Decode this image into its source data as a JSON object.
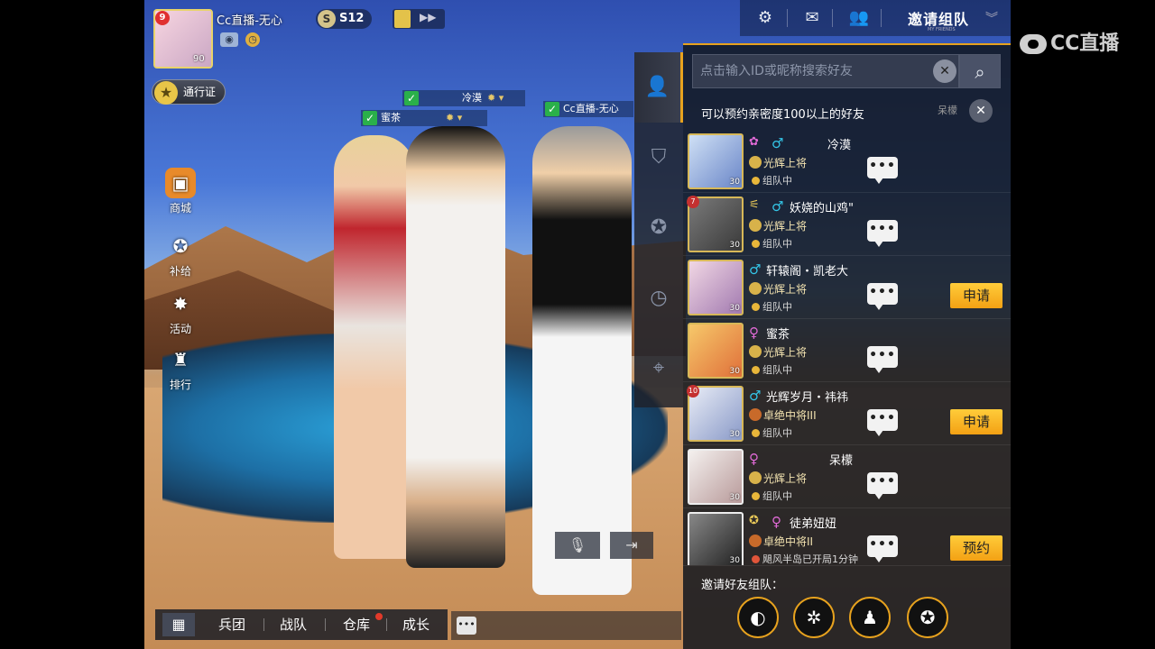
{
  "watermark": "CC直播",
  "player": {
    "name": "Cc直播-无心",
    "level_badge": "9",
    "level": "90",
    "season": "S12",
    "pass_label": "通行证"
  },
  "left_menu": [
    {
      "label": "商城",
      "icon": "shop-bag-icon"
    },
    {
      "label": "补给",
      "icon": "supply-icon"
    },
    {
      "label": "活动",
      "icon": "event-star-icon"
    },
    {
      "label": "排行",
      "icon": "ranking-icon"
    }
  ],
  "name_tags": [
    {
      "name": "冷漠"
    },
    {
      "name": "蜜茶"
    },
    {
      "name": "Cc直播-无心"
    }
  ],
  "top_nav": {
    "invite_title": "邀请组队",
    "invite_subtitle": "MY FRIENDS"
  },
  "search": {
    "placeholder": "点击输入ID或昵称搜索好友"
  },
  "hint": "可以预约亲密度100以上的好友",
  "hint_ghost": "呆檬",
  "friends": [
    {
      "name": "冷漠",
      "sex": "♂",
      "rank": "光辉上将",
      "status": "组队中",
      "level": "30",
      "action": ""
    },
    {
      "name": "妖娆的山鸡\"",
      "sex": "♂",
      "rank": "光辉上将",
      "status": "组队中",
      "level": "30",
      "vip": "7",
      "action": ""
    },
    {
      "name": "轩辕阁・凯老大",
      "sex": "♂",
      "rank": "光辉上将",
      "status": "组队中",
      "level": "30",
      "action": "申请"
    },
    {
      "name": "蜜茶",
      "sex": "♀",
      "rank": "光辉上将",
      "status": "组队中",
      "level": "30",
      "action": ""
    },
    {
      "name": "光辉岁月・祎祎",
      "sex": "♂",
      "rank": "卓绝中将III",
      "status": "组队中",
      "level": "30",
      "vip": "10",
      "action": "申请"
    },
    {
      "name": "呆檬",
      "sex": "♀",
      "rank": "光辉上将",
      "status": "组队中",
      "level": "30",
      "action": ""
    },
    {
      "name": "徒弟妞妞",
      "sex": "♀",
      "rank": "卓绝中将II",
      "status": "飓风半岛已开局1分钟",
      "level": "30",
      "action": "预约"
    }
  ],
  "chat_label": "•••",
  "invite_friends_label": "邀请好友组队：",
  "share_targets": [
    {
      "name": "wechat-icon"
    },
    {
      "name": "moments-icon"
    },
    {
      "name": "qq-icon"
    },
    {
      "name": "qzone-icon"
    }
  ],
  "bottom_nav": {
    "items": [
      "兵团",
      "战队",
      "仓库",
      "成长"
    ]
  },
  "colors": {
    "accent": "#e7a21e",
    "apply_button": "#f3a114",
    "male": "#34c6e8",
    "female": "#e06ad6"
  }
}
